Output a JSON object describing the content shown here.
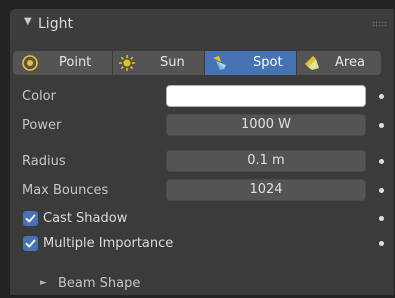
{
  "panel": {
    "title": "Light",
    "arrow": "▼"
  },
  "light_types": [
    {
      "label": "Point",
      "icon": "point-light-icon",
      "active": false
    },
    {
      "label": "Sun",
      "icon": "sun-light-icon",
      "active": false
    },
    {
      "label": "Spot",
      "icon": "spot-light-icon",
      "active": true
    },
    {
      "label": "Area",
      "icon": "area-light-icon",
      "active": false
    }
  ],
  "properties": {
    "color": {
      "label": "Color",
      "value": "#ffffff"
    },
    "power": {
      "label": "Power",
      "value": "1000 W"
    },
    "radius": {
      "label": "Radius",
      "value": "0.1 m"
    },
    "max_bounces": {
      "label": "Max Bounces",
      "value": "1024"
    }
  },
  "checkboxes": {
    "cast_shadow": {
      "label": "Cast Shadow",
      "checked": true
    },
    "multiple_importance": {
      "label": "Multiple Importance",
      "checked": true
    }
  },
  "subpanel": {
    "beam_shape": {
      "label": "Beam Shape",
      "arrow": "►"
    }
  },
  "colors": {
    "accent": "#4772b3",
    "panel_bg": "#3b3b3b",
    "field_bg": "#545454"
  }
}
